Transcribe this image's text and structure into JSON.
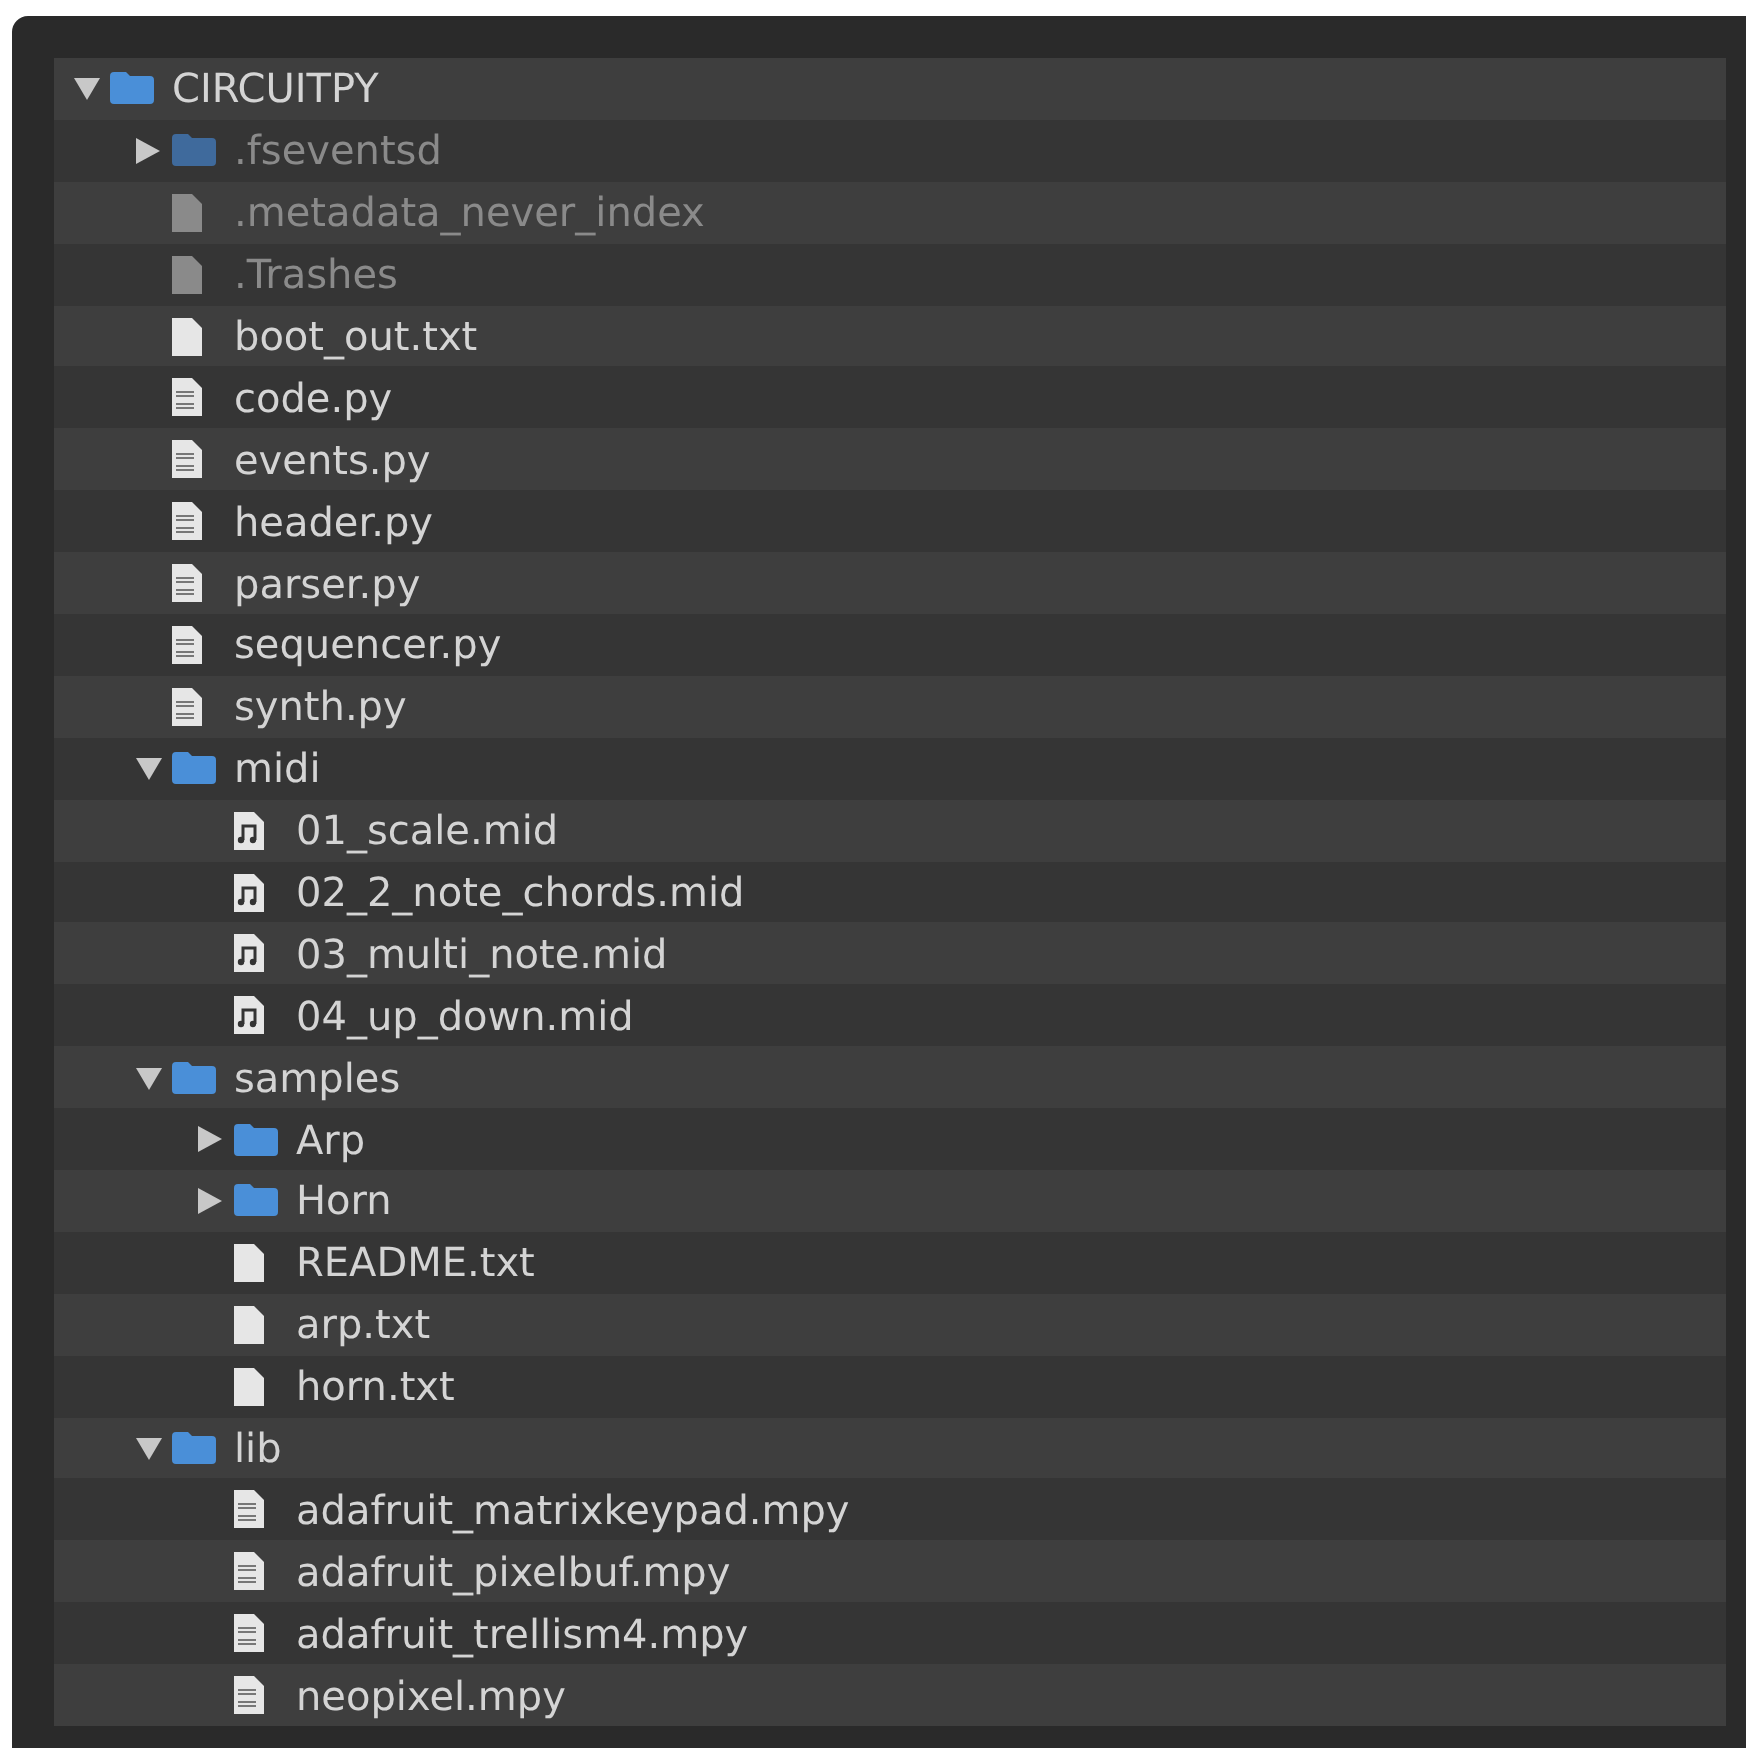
{
  "tree": [
    {
      "name": "CIRCUITPY",
      "kind": "folder",
      "expanded": true,
      "hidden": false,
      "children": [
        {
          "name": ".fseventsd",
          "kind": "folder",
          "expanded": false,
          "hidden": true
        },
        {
          "name": ".metadata_never_index",
          "kind": "file",
          "hidden": true
        },
        {
          "name": ".Trashes",
          "kind": "file",
          "hidden": true
        },
        {
          "name": "boot_out.txt",
          "kind": "file",
          "hidden": false
        },
        {
          "name": "code.py",
          "kind": "binary",
          "hidden": false
        },
        {
          "name": "events.py",
          "kind": "binary",
          "hidden": false
        },
        {
          "name": "header.py",
          "kind": "binary",
          "hidden": false
        },
        {
          "name": "parser.py",
          "kind": "binary",
          "hidden": false
        },
        {
          "name": "sequencer.py",
          "kind": "binary",
          "hidden": false
        },
        {
          "name": "synth.py",
          "kind": "binary",
          "hidden": false
        },
        {
          "name": "midi",
          "kind": "folder",
          "expanded": true,
          "hidden": false,
          "children": [
            {
              "name": "01_scale.mid",
              "kind": "music",
              "hidden": false
            },
            {
              "name": "02_2_note_chords.mid",
              "kind": "music",
              "hidden": false
            },
            {
              "name": "03_multi_note.mid",
              "kind": "music",
              "hidden": false
            },
            {
              "name": "04_up_down.mid",
              "kind": "music",
              "hidden": false
            }
          ]
        },
        {
          "name": "samples",
          "kind": "folder",
          "expanded": true,
          "hidden": false,
          "children": [
            {
              "name": "Arp",
              "kind": "folder",
              "expanded": false,
              "hidden": false
            },
            {
              "name": "Horn",
              "kind": "folder",
              "expanded": false,
              "hidden": false
            },
            {
              "name": "README.txt",
              "kind": "file",
              "hidden": false
            },
            {
              "name": "arp.txt",
              "kind": "file",
              "hidden": false
            },
            {
              "name": "horn.txt",
              "kind": "file",
              "hidden": false
            }
          ]
        },
        {
          "name": "lib",
          "kind": "folder",
          "expanded": true,
          "hidden": false,
          "children": [
            {
              "name": "adafruit_matrixkeypad.mpy",
              "kind": "binary",
              "hidden": false
            },
            {
              "name": "adafruit_pixelbuf.mpy",
              "kind": "binary",
              "hidden": false
            },
            {
              "name": "adafruit_trellism4.mpy",
              "kind": "binary",
              "hidden": false
            },
            {
              "name": "neopixel.mpy",
              "kind": "binary",
              "hidden": false
            }
          ]
        }
      ]
    }
  ]
}
